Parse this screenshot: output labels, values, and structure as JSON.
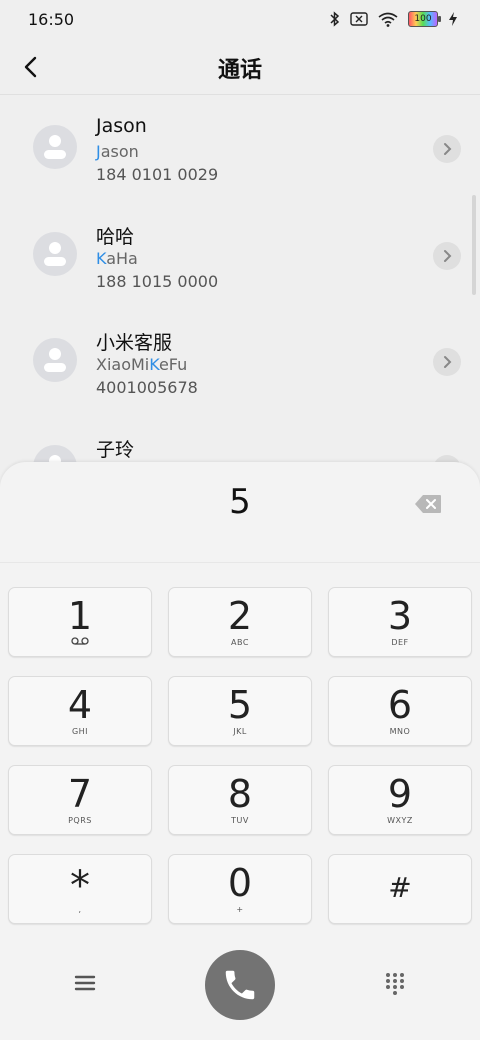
{
  "status_bar": {
    "time": "16:50",
    "battery": "100",
    "icons": [
      "bluetooth-icon",
      "sim-off-icon",
      "wifi-icon",
      "battery-icon",
      "charging-icon"
    ]
  },
  "header": {
    "title": "通话"
  },
  "contacts": [
    {
      "name": "Jason",
      "pinyin_highlight": "J",
      "pinyin_rest": "ason",
      "number": "184 0101 0029"
    },
    {
      "name": "哈哈",
      "pinyin_highlight": "K",
      "pinyin_rest": "aHa",
      "number": "188 1015 0000"
    },
    {
      "name": "小米客服",
      "pinyin_pre": "XiaoMi",
      "pinyin_highlight": "K",
      "pinyin_rest": "eFu",
      "number": "4001005678"
    },
    {
      "name": "子玲",
      "pinyin_highlight": "",
      "pinyin_rest": "",
      "number": ""
    }
  ],
  "dialpad": {
    "display": "5",
    "keys": [
      {
        "digit": "1",
        "letters": ""
      },
      {
        "digit": "2",
        "letters": "ABC"
      },
      {
        "digit": "3",
        "letters": "DEF"
      },
      {
        "digit": "4",
        "letters": "GHI"
      },
      {
        "digit": "5",
        "letters": "JKL"
      },
      {
        "digit": "6",
        "letters": "MNO"
      },
      {
        "digit": "7",
        "letters": "PQRS"
      },
      {
        "digit": "8",
        "letters": "TUV"
      },
      {
        "digit": "9",
        "letters": "WXYZ"
      },
      {
        "digit": "*",
        "letters": ","
      },
      {
        "digit": "0",
        "letters": "+"
      },
      {
        "digit": "#",
        "letters": ""
      }
    ]
  },
  "colors": {
    "highlight": "#2f8ee5",
    "call_button": "#737373",
    "background": "#efefef"
  }
}
